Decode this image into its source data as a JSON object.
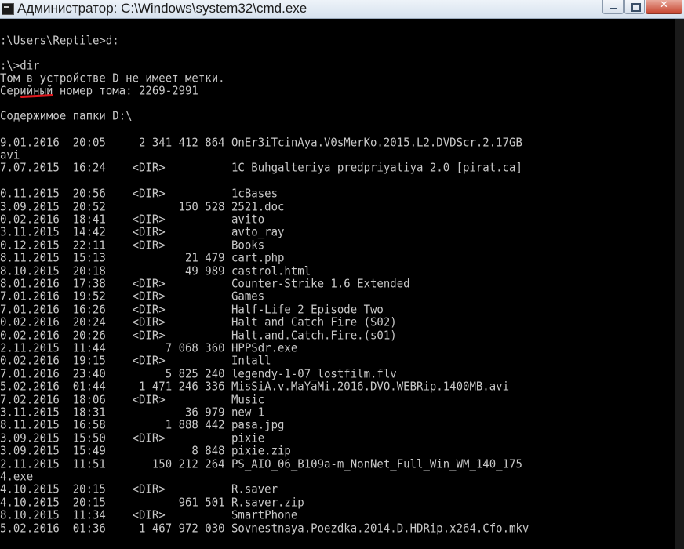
{
  "window": {
    "title": "Администратор: C:\\Windows\\system32\\cmd.exe",
    "icon": "cmd-console-icon",
    "colors": {
      "background": "#000000",
      "text": "#c8c8c8",
      "annotation": "#e0171d"
    }
  },
  "console": {
    "lines": [
      ":\\Users\\Reptile>d:",
      "",
      ":\\>dir",
      "Том в устройстве D не имеет метки.",
      "Серийный номер тома: 2269-2991",
      "",
      "Содержимое папки D:\\",
      "",
      "9.01.2016  20:05     2 341 412 864 OnEr3iTcinAya.V0sMerKo.2015.L2.DVDScr.2.17GB",
      "avi",
      "7.07.2015  16:24    <DIR>          1C Buhgalteriya predpriyatiya 2.0 [pirat.ca]",
      "",
      "0.11.2015  20:56    <DIR>          1cBases",
      "3.09.2015  20:52           150 528 2521.doc",
      "0.02.2016  18:41    <DIR>          avito",
      "3.11.2015  14:42    <DIR>          avto_ray",
      "0.12.2015  22:11    <DIR>          Books",
      "8.11.2015  15:13            21 479 cart.php",
      "8.10.2015  20:18            49 989 castrol.html",
      "8.01.2016  17:38    <DIR>          Counter-Strike 1.6 Extended",
      "7.01.2016  19:52    <DIR>          Games",
      "7.01.2016  16:26    <DIR>          Half-Life 2 Episode Two",
      "0.02.2016  20:24    <DIR>          Halt and Catch Fire (S02)",
      "0.02.2016  20:26    <DIR>          Halt.and.Catch.Fire.(s01)",
      "2.11.2015  11:44         7 068 360 HPPSdr.exe",
      "0.02.2016  19:15    <DIR>          Intall",
      "7.01.2016  23:40         5 825 240 legendy-1-07_lostfilm.flv",
      "5.02.2016  01:44     1 471 246 336 MisSiA.v.MaYaMi.2016.DVO.WEBRip.1400MB.avi",
      "7.02.2016  18:06    <DIR>          Music",
      "3.11.2015  18:31            36 979 new 1",
      "8.11.2015  16:58         1 888 442 pasa.jpg",
      "3.09.2015  15:50    <DIR>          pixie",
      "3.09.2015  15:49             8 848 pixie.zip",
      "2.11.2015  11:51       150 212 264 PS_AIO_06_B109a-m_NonNet_Full_Win_WM_140_175",
      "4.exe",
      "4.10.2015  20:15    <DIR>          R.saver",
      "4.10.2015  20:15           961 501 R.saver.zip",
      "8.10.2015  11:34    <DIR>          SmartPhone",
      "5.02.2016  01:36     1 467 972 030 Sovnestnaya.Poezdka.2014.D.HDRip.x264.Cfo.mkv"
    ]
  }
}
